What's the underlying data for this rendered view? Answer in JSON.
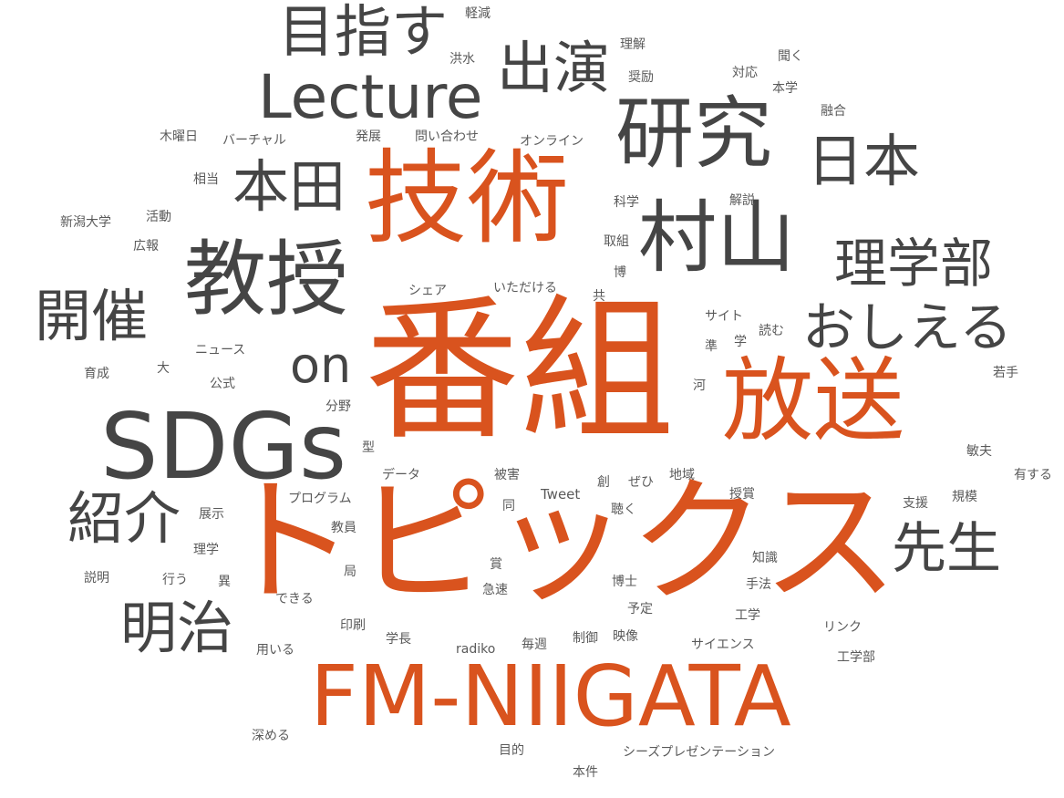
{
  "colors": {
    "accent": "#d9531e",
    "dark": "#454545",
    "light": "#5a5a5a",
    "background": "#ffffff"
  },
  "words": [
    {
      "text": "番組",
      "tone": "accent"
    },
    {
      "text": "トピックス",
      "tone": "accent"
    },
    {
      "text": "FM-NIIGATA",
      "tone": "accent"
    },
    {
      "text": "技術",
      "tone": "accent"
    },
    {
      "text": "放送",
      "tone": "accent"
    },
    {
      "text": "SDGs",
      "tone": "dark"
    },
    {
      "text": "研究",
      "tone": "dark"
    },
    {
      "text": "村山",
      "tone": "dark"
    },
    {
      "text": "教授",
      "tone": "dark"
    },
    {
      "text": "Lecture",
      "tone": "dark"
    },
    {
      "text": "目指す",
      "tone": "dark"
    },
    {
      "text": "出演",
      "tone": "dark"
    },
    {
      "text": "本田",
      "tone": "dark"
    },
    {
      "text": "日本",
      "tone": "dark"
    },
    {
      "text": "理学部",
      "tone": "dark"
    },
    {
      "text": "おしえる",
      "tone": "dark"
    },
    {
      "text": "開催",
      "tone": "dark"
    },
    {
      "text": "on",
      "tone": "dark"
    },
    {
      "text": "紹介",
      "tone": "dark"
    },
    {
      "text": "明治",
      "tone": "dark"
    },
    {
      "text": "先生",
      "tone": "dark"
    },
    {
      "text": "軽減",
      "tone": "light"
    },
    {
      "text": "洪水",
      "tone": "light"
    },
    {
      "text": "理解",
      "tone": "light"
    },
    {
      "text": "聞く",
      "tone": "light"
    },
    {
      "text": "奨励",
      "tone": "light"
    },
    {
      "text": "対応",
      "tone": "light"
    },
    {
      "text": "本学",
      "tone": "light"
    },
    {
      "text": "融合",
      "tone": "light"
    },
    {
      "text": "木曜日",
      "tone": "light"
    },
    {
      "text": "バーチャル",
      "tone": "light"
    },
    {
      "text": "発展",
      "tone": "light"
    },
    {
      "text": "問い合わせ",
      "tone": "light"
    },
    {
      "text": "オンライン",
      "tone": "light"
    },
    {
      "text": "相当",
      "tone": "light"
    },
    {
      "text": "科学",
      "tone": "light"
    },
    {
      "text": "解説",
      "tone": "light"
    },
    {
      "text": "新潟大学",
      "tone": "light"
    },
    {
      "text": "活動",
      "tone": "light"
    },
    {
      "text": "広報",
      "tone": "light"
    },
    {
      "text": "取組",
      "tone": "light"
    },
    {
      "text": "博",
      "tone": "light"
    },
    {
      "text": "シェア",
      "tone": "light"
    },
    {
      "text": "いただける",
      "tone": "light"
    },
    {
      "text": "共",
      "tone": "light"
    },
    {
      "text": "サイト",
      "tone": "light"
    },
    {
      "text": "読む",
      "tone": "light"
    },
    {
      "text": "準",
      "tone": "light"
    },
    {
      "text": "学",
      "tone": "light"
    },
    {
      "text": "ニュース",
      "tone": "light"
    },
    {
      "text": "育成",
      "tone": "light"
    },
    {
      "text": "大",
      "tone": "light"
    },
    {
      "text": "公式",
      "tone": "light"
    },
    {
      "text": "若手",
      "tone": "light"
    },
    {
      "text": "河",
      "tone": "light"
    },
    {
      "text": "分野",
      "tone": "light"
    },
    {
      "text": "型",
      "tone": "light"
    },
    {
      "text": "敏夫",
      "tone": "light"
    },
    {
      "text": "データ",
      "tone": "light"
    },
    {
      "text": "被害",
      "tone": "light"
    },
    {
      "text": "創",
      "tone": "light"
    },
    {
      "text": "ぜひ",
      "tone": "light"
    },
    {
      "text": "地域",
      "tone": "light"
    },
    {
      "text": "有する",
      "tone": "light"
    },
    {
      "text": "Tweet",
      "tone": "light"
    },
    {
      "text": "授賞",
      "tone": "light"
    },
    {
      "text": "規模",
      "tone": "light"
    },
    {
      "text": "プログラム",
      "tone": "light"
    },
    {
      "text": "同",
      "tone": "light"
    },
    {
      "text": "聴く",
      "tone": "light"
    },
    {
      "text": "支援",
      "tone": "light"
    },
    {
      "text": "展示",
      "tone": "light"
    },
    {
      "text": "教員",
      "tone": "light"
    },
    {
      "text": "理学",
      "tone": "light"
    },
    {
      "text": "賞",
      "tone": "light"
    },
    {
      "text": "知識",
      "tone": "light"
    },
    {
      "text": "説明",
      "tone": "light"
    },
    {
      "text": "行う",
      "tone": "light"
    },
    {
      "text": "異",
      "tone": "light"
    },
    {
      "text": "局",
      "tone": "light"
    },
    {
      "text": "博士",
      "tone": "light"
    },
    {
      "text": "手法",
      "tone": "light"
    },
    {
      "text": "できる",
      "tone": "light"
    },
    {
      "text": "急速",
      "tone": "light"
    },
    {
      "text": "予定",
      "tone": "light"
    },
    {
      "text": "工学",
      "tone": "light"
    },
    {
      "text": "印刷",
      "tone": "light"
    },
    {
      "text": "リンク",
      "tone": "light"
    },
    {
      "text": "学長",
      "tone": "light"
    },
    {
      "text": "制御",
      "tone": "light"
    },
    {
      "text": "映像",
      "tone": "light"
    },
    {
      "text": "用いる",
      "tone": "light"
    },
    {
      "text": "radiko",
      "tone": "light"
    },
    {
      "text": "毎週",
      "tone": "light"
    },
    {
      "text": "サイエンス",
      "tone": "light"
    },
    {
      "text": "工学部",
      "tone": "light"
    },
    {
      "text": "深める",
      "tone": "light"
    },
    {
      "text": "目的",
      "tone": "light"
    },
    {
      "text": "シーズプレゼンテーション",
      "tone": "light"
    },
    {
      "text": "本件",
      "tone": "light"
    }
  ]
}
